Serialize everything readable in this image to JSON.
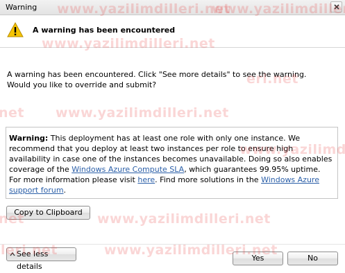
{
  "window": {
    "title": "Warning"
  },
  "header": {
    "heading": "A warning has been encountered"
  },
  "message": {
    "line1": "A warning has been encountered.  Click \"See more details\" to see the warning.",
    "line2": "Would you like to override and submit?"
  },
  "details": {
    "label": "Warning:",
    "text1": " This deployment has at least one role with only one instance. We recommend that you deploy at least two instances per role to ensure high availability in case one of the instances becomes unavailable. Doing so also enables coverage of the ",
    "link_sla": "Windows Azure Compute SLA",
    "text2": ", which guarantees 99.95% uptime. For more information please visit ",
    "link_here": "here",
    "text3": ". Find more solutions in the ",
    "link_forum": "Windows Azure support forum",
    "text4": "."
  },
  "buttons": {
    "copy": "Copy to Clipboard",
    "less_details": "See less details",
    "yes": "Yes",
    "no": "No"
  },
  "watermark": {
    "text": "www.yazilimdilleri.net",
    "fragment": "net",
    "fragment2": "eri.net",
    "fragment3": "lleri.net"
  },
  "colors": {
    "link": "#2b5fa8",
    "warning_icon": "#f5c400",
    "watermark": "#e84646"
  }
}
